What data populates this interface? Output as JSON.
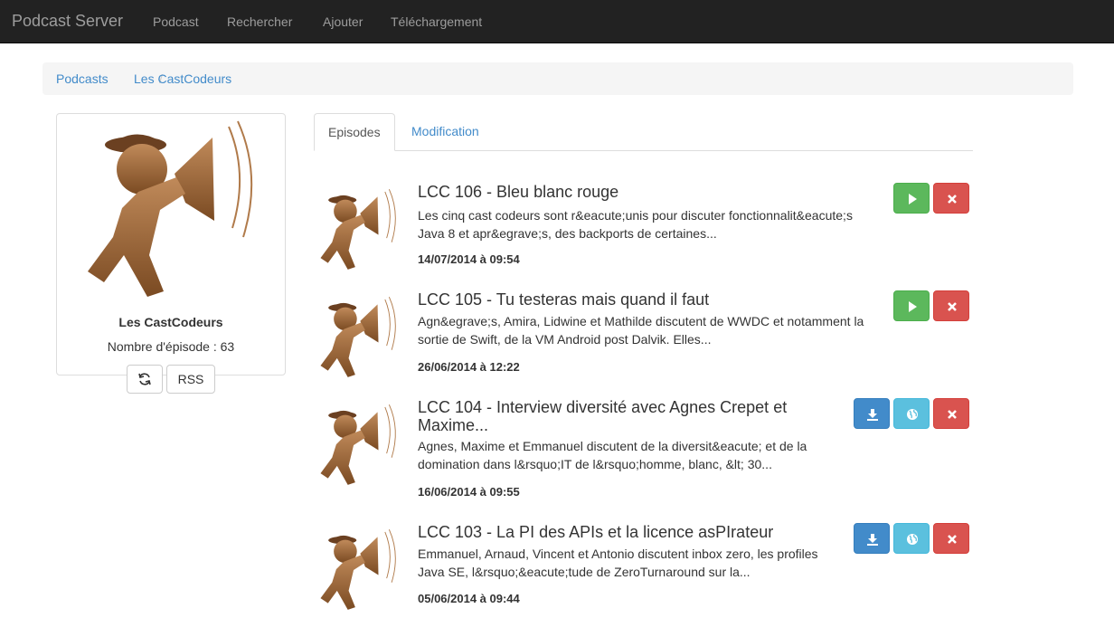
{
  "navbar": {
    "brand": "Podcast Server",
    "links": [
      "Podcast",
      "Rechercher",
      "Ajouter",
      "Téléchargement"
    ]
  },
  "breadcrumb": [
    "Podcasts",
    "Les CastCodeurs"
  ],
  "breadcrumb_separator": "/",
  "podcast": {
    "title": "Les CastCodeurs",
    "count_label": "Nombre d'épisode : ",
    "count": "63",
    "rss_label": "RSS",
    "refresh_icon": "refresh-icon"
  },
  "tabs": [
    "Episodes",
    "Modification"
  ],
  "episodes": [
    {
      "title": "LCC 106 - Bleu blanc rouge",
      "desc1": "Les cinq cast codeurs sont r&eacute;unis pour discuter fonctionnalit&eacute;s",
      "desc2": "Java 8 et apr&egrave;s, des backports de certaines...",
      "date": "14/07/2014 à 09:54",
      "actions": [
        "play",
        "delete"
      ]
    },
    {
      "title": "LCC 105 - Tu testeras mais quand il faut",
      "desc1": "Agn&egrave;s, Amira, Lidwine et Mathilde discutent de WWDC et notamment la",
      "desc2": "sortie de Swift, de la VM Android post Dalvik. Elles...",
      "date": "26/06/2014 à 12:22",
      "actions": [
        "play",
        "delete"
      ]
    },
    {
      "title": "LCC 104 - Interview diversité avec Agnes Crepet et",
      "title2": "Maxime...",
      "desc1": "Agnes, Maxime et Emmanuel discutent de la diversit&eacute; et de la",
      "desc2": "domination dans l&rsquo;IT de l&rsquo;homme, blanc, &lt; 30...",
      "date": "16/06/2014 à 09:55",
      "actions": [
        "download",
        "web",
        "delete"
      ]
    },
    {
      "title": "LCC 103 - La PI des APIs et la licence asPIrateur",
      "desc1": "Emmanuel, Arnaud, Vincent et Antonio discutent inbox zero, les profiles",
      "desc2": "Java SE, l&rsquo;&eacute;tude de ZeroTurnaround sur la...",
      "date": "05/06/2014 à 09:44",
      "actions": [
        "download",
        "web",
        "delete"
      ]
    }
  ],
  "colors": {
    "navbar": "#222222",
    "link": "#428bca",
    "success": "#5cb85c",
    "danger": "#d9534f",
    "primary": "#428bca",
    "info": "#5bc0de"
  }
}
